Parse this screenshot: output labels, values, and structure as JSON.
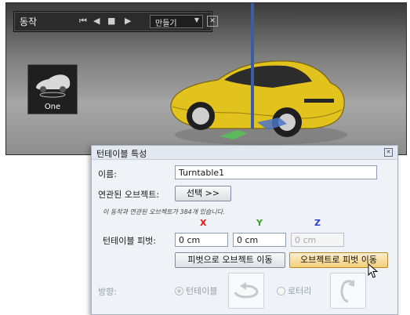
{
  "action_bar": {
    "title": "동작",
    "controls": [
      "⏮",
      "◀",
      "■",
      "▶"
    ],
    "dropdown_value": "만들기",
    "dropdown_arrow": "▼",
    "close_glyph": "✕"
  },
  "thumbnail": {
    "label": "One"
  },
  "panel": {
    "title": "턴테이블 특성",
    "close_glyph": "✕",
    "name_label": "이름:",
    "name_value": "Turntable1",
    "related_label": "연관된 오브젝트:",
    "select_button": "선택 >>",
    "note": "이 동작과 연관된 오브젝트가 384개 있습니다.",
    "axis_x": "X",
    "axis_y": "Y",
    "axis_z": "Z",
    "pivot_label": "턴테이블 피벗:",
    "pivot_x": "0 cm",
    "pivot_y": "0 cm",
    "pivot_z": "0 cm",
    "move_object_to_pivot": "피벗으로 오브젝트 이동",
    "move_pivot_to_object": "오브젝트로 피벗 이동",
    "direction_label": "방향:",
    "option_turntable": "턴테이블",
    "option_rotary": "로터리"
  },
  "colors": {
    "axis_x": "#e01818",
    "axis_y": "#3aa22a",
    "axis_z": "#2a3fd6",
    "car": "#e2c21c"
  },
  "icons": [
    "close-icon",
    "turntable-rotation-icon",
    "rotary-rotation-icon",
    "mouse-cursor-icon",
    "car-thumbnail-icon"
  ]
}
